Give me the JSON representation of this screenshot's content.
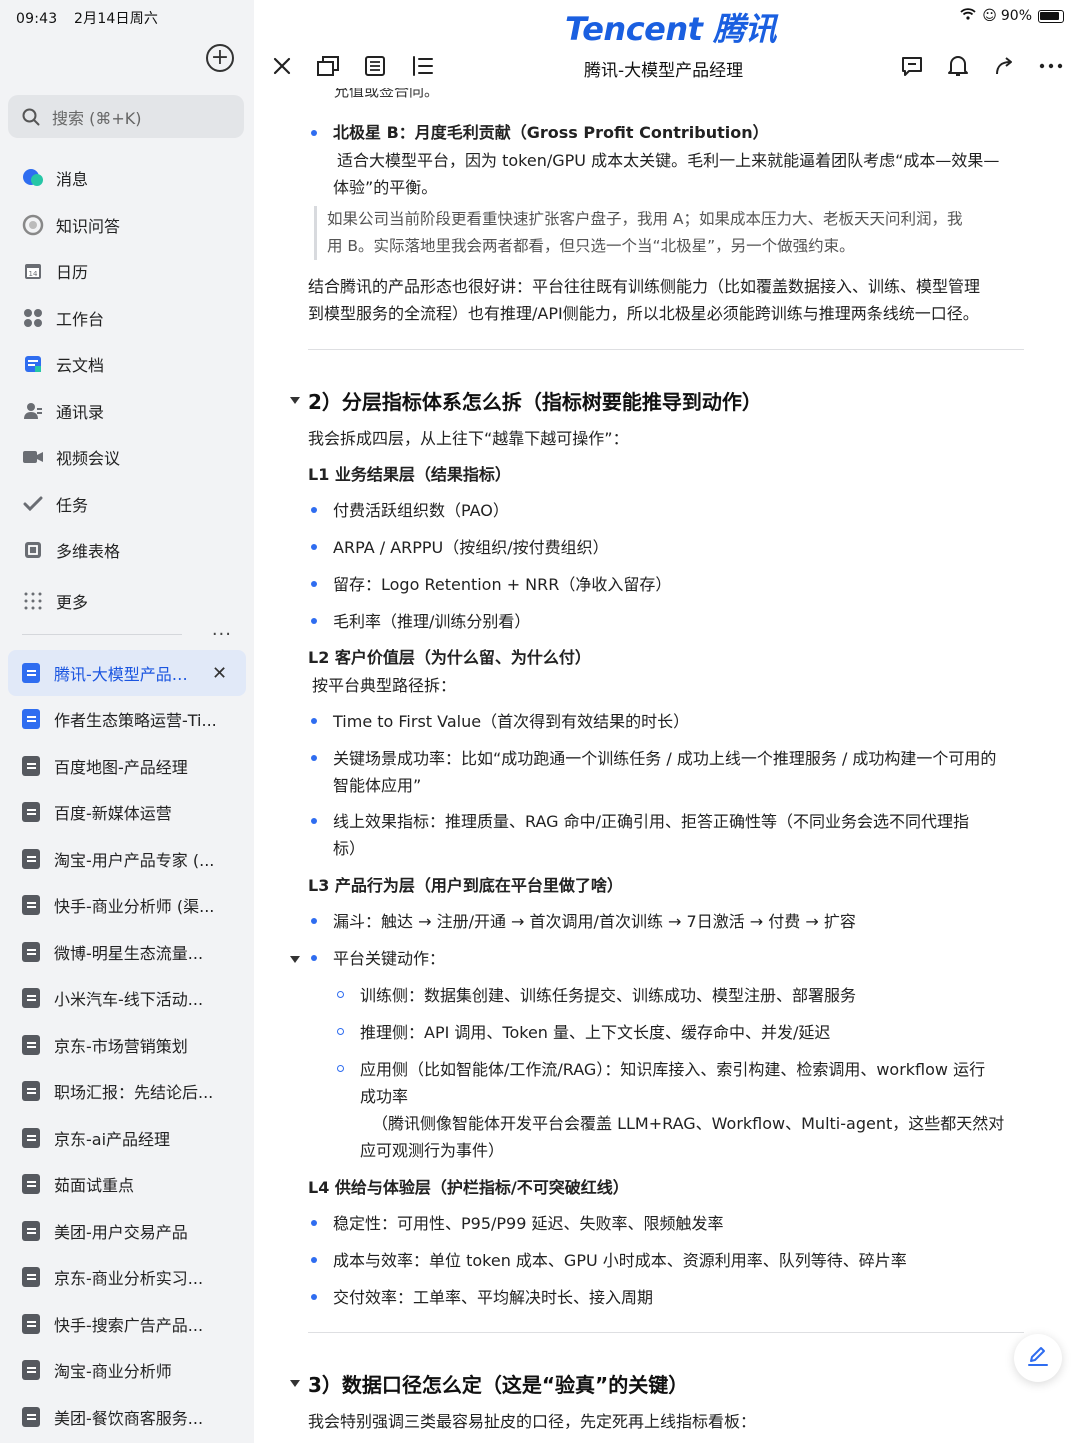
{
  "status": {
    "time": "09:43",
    "date": "2月14日周六",
    "battery": "90%"
  },
  "brand": "Tencent 腾讯",
  "search": {
    "placeholder": "搜索 (⌘+K)"
  },
  "nav": [
    {
      "label": "消息",
      "icon": "message-icon"
    },
    {
      "label": "知识问答",
      "icon": "qa-icon"
    },
    {
      "label": "日历",
      "icon": "calendar-icon"
    },
    {
      "label": "工作台",
      "icon": "workbench-icon"
    },
    {
      "label": "云文档",
      "icon": "cloud-doc-icon"
    },
    {
      "label": "通讯录",
      "icon": "contacts-icon"
    },
    {
      "label": "视频会议",
      "icon": "video-icon"
    },
    {
      "label": "任务",
      "icon": "task-icon"
    },
    {
      "label": "多维表格",
      "icon": "table-icon"
    },
    {
      "label": "更多",
      "icon": "more-grid-icon"
    }
  ],
  "docs": [
    {
      "label": "腾讯-大模型产品经理"
    },
    {
      "label": "作者生态策略运营-Ti..."
    },
    {
      "label": "百度地图-产品经理"
    },
    {
      "label": "百度-新媒体运营"
    },
    {
      "label": "淘宝-用户产品专家 (..."
    },
    {
      "label": "快手-商业分析师 (渠..."
    },
    {
      "label": "微博-明星生态流量..."
    },
    {
      "label": "小米汽车-线下活动..."
    },
    {
      "label": "京东-市场营销策划"
    },
    {
      "label": "职场汇报：先结论后..."
    },
    {
      "label": "京东-ai产品经理"
    },
    {
      "label": "茹面试重点"
    },
    {
      "label": "美团-用户交易产品"
    },
    {
      "label": "京东-商业分析实习..."
    },
    {
      "label": "快手-搜索广告产品..."
    },
    {
      "label": "淘宝-商业分析师"
    },
    {
      "label": "美团-餐饮商客服务..."
    }
  ],
  "doc_title": "腾讯-大模型产品经理",
  "content": {
    "clip_top": "允值或签合同。",
    "b1_title": "北极星 B：月度毛利贡献（Gross Profit Contribution）",
    "b1_line1": "适合大模型平台，因为 token/GPU 成本太关键。毛利一上来就能逼着团队考虑“成本—效果—",
    "b1_line2": "体验”的平衡。",
    "quote1": "如果公司当前阶段更看重快速扩张客户盘子，我用 A；如果成本压力大、老板天天问利润，我",
    "quote2": "用 B。实际落地里我会两者都看，但只选一个当“北极星”，另一个做强约束。",
    "p1a": "结合腾讯的产品形态也很好讲：平台往往既有训练侧能力（比如覆盖数据接入、训练、模型管理",
    "p1b": "到模型服务的全流程）也有推理/API侧能力，所以北极星必须能跨训练与推理两条线统一口径。",
    "h2": "2）分层指标体系怎么拆（指标树要能推导到动作）",
    "intro": "我会拆成四层，从上往下“越靠下越可操作”：",
    "l1": "L1 业务结果层（结果指标）",
    "l1_items": [
      "付费活跃组织数（PAO）",
      "ARPA / ARPPU（按组织/按付费组织）",
      "留存：Logo Retention + NRR（净收入留存）",
      "毛利率（推理/训练分别看）"
    ],
    "l2": "L2 客户价值层（为什么留、为什么付）",
    "l2_sub": "按平台典型路径拆：",
    "l2_i1": "Time to First Value（首次得到有效结果的时长）",
    "l2_i2a": "关键场景成功率：比如“成功跑通一个训练任务 / 成功上线一个推理服务 / 成功构建一个可用的",
    "l2_i2b": "智能体应用”",
    "l2_i3a": "线上效果指标：推理质量、RAG 命中/正确引用、拒答正确性等（不同业务会选不同代理指",
    "l2_i3b": "标）",
    "l3": "L3 产品行为层（用户到底在平台里做了啥）",
    "l3_i1": "漏斗：触达 → 注册/开通 → 首次调用/首次训练 → 7日激活 → 付费 → 扩容",
    "l3_i2": "平台关键动作：",
    "l3_s1": "训练侧：数据集创建、训练任务提交、训练成功、模型注册、部署服务",
    "l3_s2": "推理侧：API 调用、Token 量、上下文长度、缓存命中、并发/延迟",
    "l3_s3a": "应用侧（比如智能体/工作流/RAG）：知识库接入、索引构建、检索调用、workflow 运行",
    "l3_s3b": "成功率",
    "l3_s3c": "（腾讯侧像智能体开发平台会覆盖 LLM+RAG、Workflow、Multi-agent，这些都天然对",
    "l3_s3d": "应可观测行为事件）",
    "l4": "L4 供给与体验层（护栏指标/不可突破红线）",
    "l4_items": [
      "稳定性：可用性、P95/P99 延迟、失败率、限频触发率",
      "成本与效率：单位 token 成本、GPU 小时成本、资源利用率、队列等待、碎片率",
      "交付效率：工单率、平均解决时长、接入周期"
    ],
    "h3": "3）数据口径怎么定（这是“验真”的关键）",
    "last": "我会特别强调三类最容易扯皮的口径，先定死再上线指标看板："
  }
}
